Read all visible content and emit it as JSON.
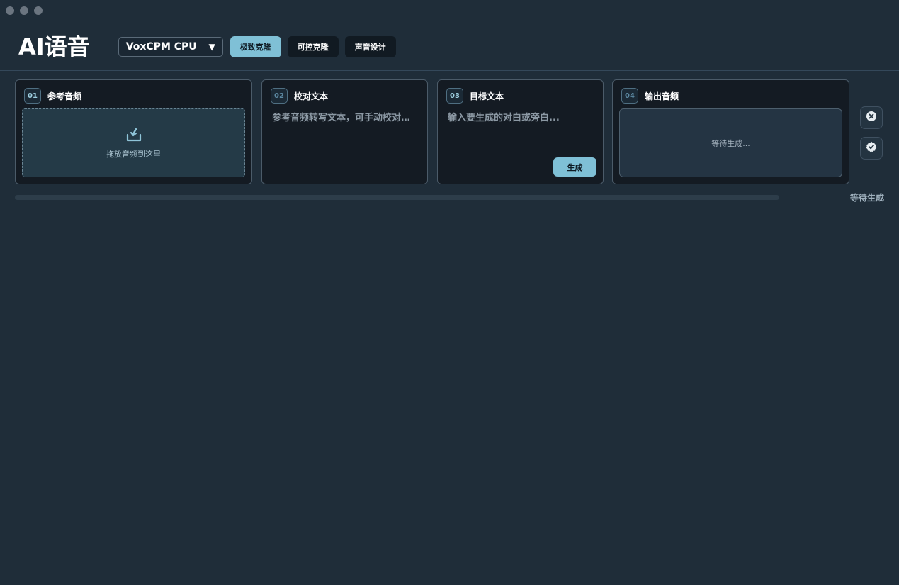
{
  "app": {
    "title": "AI语音"
  },
  "toolbar": {
    "model_value": "VoxCPM CPU",
    "modes": [
      {
        "label": "极致克隆",
        "active": true
      },
      {
        "label": "可控克隆",
        "active": false
      },
      {
        "label": "声音设计",
        "active": false
      }
    ]
  },
  "panels": [
    {
      "num": "01",
      "title": "参考音频",
      "dropzone_text": "拖放音频到这里",
      "icon": "download-tray-icon"
    },
    {
      "num": "02",
      "title": "校对文本",
      "placeholder": "参考音频转写文本，可手动校对…"
    },
    {
      "num": "03",
      "title": "目标文本",
      "placeholder": "输入要生成的对白或旁白...",
      "button_label": "生成"
    },
    {
      "num": "04",
      "title": "输出音频",
      "output_text": "等待生成..."
    }
  ],
  "side_buttons": [
    {
      "icon": "close-circle-icon"
    },
    {
      "icon": "verified-badge-icon"
    }
  ],
  "progress": {
    "value": 0,
    "status": "等待生成"
  },
  "colors": {
    "accent": "#7fc0d6",
    "background": "#1f2d39",
    "panel": "#141b23"
  }
}
